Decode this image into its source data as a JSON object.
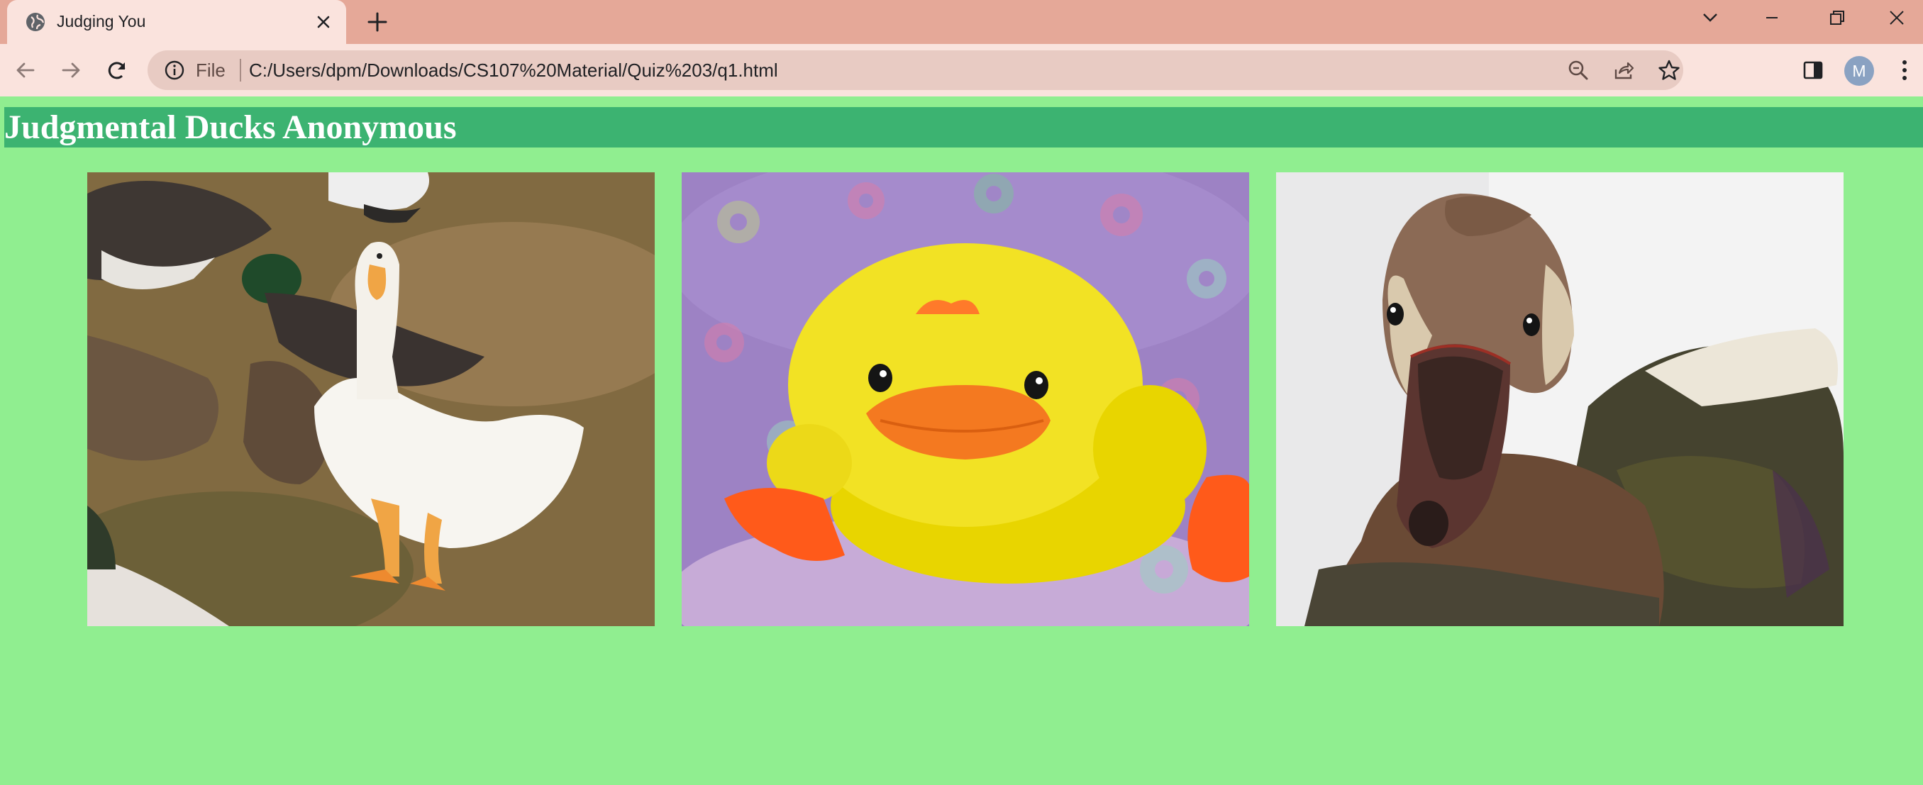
{
  "browser": {
    "tab": {
      "title": "Judging You",
      "favicon": "globe-icon",
      "close_icon": "close-icon"
    },
    "new_tab_icon": "plus-icon",
    "window_controls": [
      "chevron-down-icon",
      "minimize-icon",
      "restore-icon",
      "close-icon"
    ],
    "nav": [
      "back-arrow-icon",
      "forward-arrow-icon",
      "reload-icon"
    ],
    "address_bar": {
      "scheme_label": "File",
      "url": "C:/Users/dpm/Downloads/CS107%20Material/Quiz%203/q1.html",
      "icons": [
        "info-icon",
        "zoom-icon",
        "share-icon",
        "star-icon"
      ]
    },
    "side_panel_icon": "side-panel-icon",
    "profile_initial": "M",
    "menu_icon": "kebab-menu-icon",
    "colors": {
      "tab_strip": "#e5a898",
      "toolbar": "#fae3dd",
      "omnibox": "#e8cbc3"
    }
  },
  "page": {
    "title": "Judgmental Ducks Anonymous",
    "colors": {
      "background": "#90ee90",
      "header": "#3cb371",
      "title_text": "#ffffff"
    },
    "images": [
      {
        "subject": "white duck standing on grass among mallards"
      },
      {
        "subject": "yellow plush toy duck on purple fabric"
      },
      {
        "subject": "close-up of brown duck head facing camera"
      }
    ]
  }
}
